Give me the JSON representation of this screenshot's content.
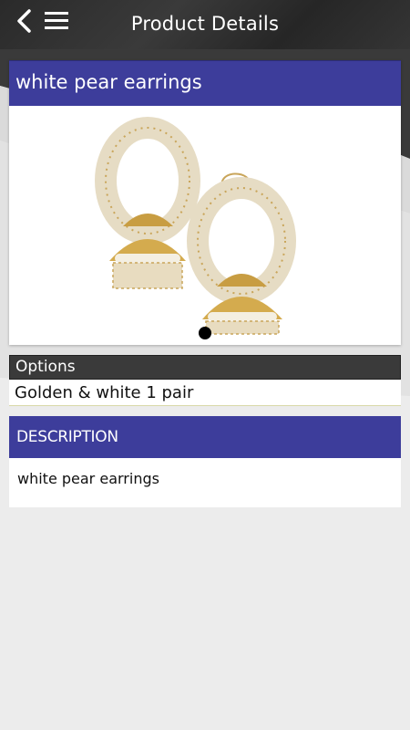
{
  "header": {
    "title": "Product Details",
    "back_icon": "chevron-left-icon",
    "menu_icon": "hamburger-menu-icon"
  },
  "product": {
    "title": "white pear earrings",
    "image": "pearl-jhumka-earrings-image",
    "carousel_dots": 1,
    "active_dot": 1
  },
  "options": {
    "label": "Options",
    "value": "Golden & white 1 pair"
  },
  "description": {
    "header": "DESCRIPTION",
    "text": "white pear earrings"
  },
  "colors": {
    "accent": "#3d3d9b",
    "topbar": "#2f2f2f",
    "options_bar": "#3a3a3a",
    "background": "#ececec"
  }
}
